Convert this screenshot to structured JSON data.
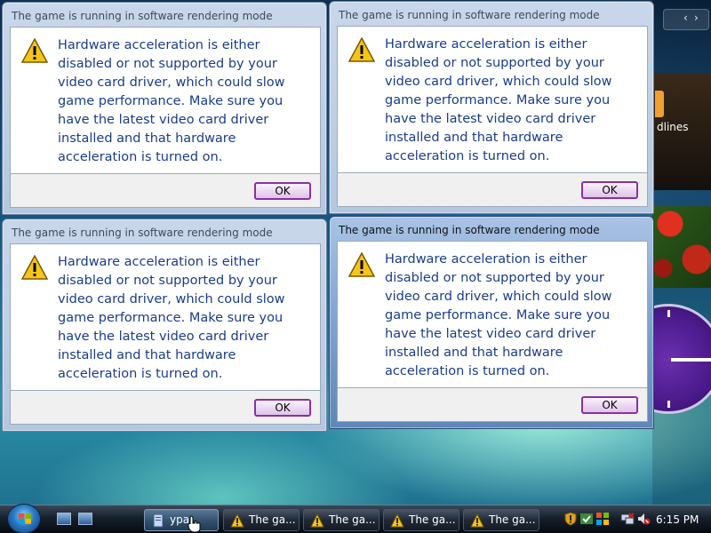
{
  "dialogs": [
    {
      "title": "The game is running in software rendering mode",
      "message": "Hardware acceleration is either disabled or not supported by your video card driver, which could slow game performance. Make sure you have the latest video card driver installed and that hardware acceleration is turned on.",
      "ok_label": "OK",
      "active": false
    },
    {
      "title": "The game is running in software rendering mode",
      "message": "Hardware acceleration is either disabled or not supported by your video card driver, which could slow game performance. Make sure you have the latest video card driver installed and that hardware acceleration is turned on.",
      "ok_label": "OK",
      "active": false
    },
    {
      "title": "The game is running in software rendering mode",
      "message": "Hardware acceleration is either disabled or not supported by your video card driver, which could slow game performance. Make sure you have the latest video card driver installed and that hardware acceleration is turned on.",
      "ok_label": "OK",
      "active": false
    },
    {
      "title": "The game is running in software rendering mode",
      "message": "Hardware acceleration is either disabled or not supported by your video card driver, which could slow game performance. Make sure you have the latest video card driver installed and that hardware acceleration is turned on.",
      "ok_label": "OK",
      "active": true
    }
  ],
  "sidebar": {
    "nav_prev": "‹",
    "nav_next": "›",
    "headlines_label": "dlines"
  },
  "taskbar": {
    "buttons": [
      {
        "label": "ypa",
        "icon": "document-icon",
        "pressed": true
      },
      {
        "label": "The ga...",
        "icon": "warning-icon",
        "pressed": false
      },
      {
        "label": "The ga...",
        "icon": "warning-icon",
        "pressed": false
      },
      {
        "label": "The ga...",
        "icon": "warning-icon",
        "pressed": false
      },
      {
        "label": "The ga...",
        "icon": "warning-icon",
        "pressed": false
      }
    ],
    "clock": "6:15 PM"
  },
  "colors": {
    "message_text": "#1a3d8a",
    "ok_border": "#8a2fa6",
    "warning_yellow": "#f5c518"
  }
}
